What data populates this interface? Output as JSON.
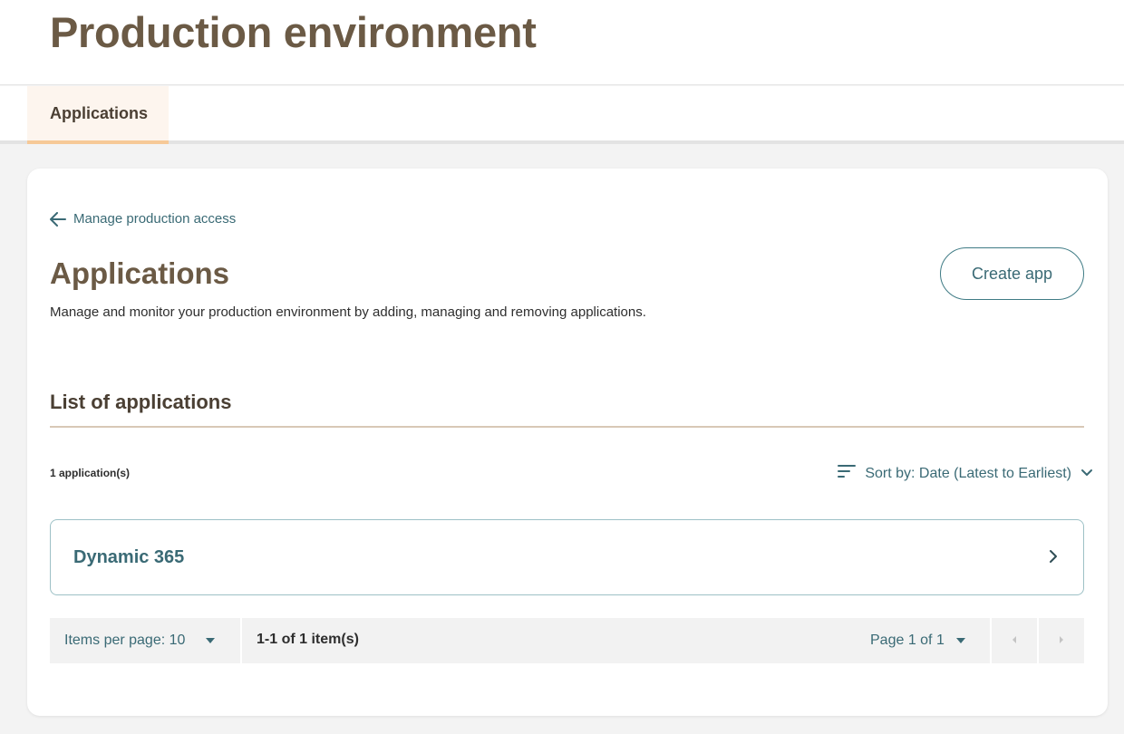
{
  "header": {
    "title": "Production environment"
  },
  "tabs": [
    {
      "label": "Applications",
      "active": true
    }
  ],
  "back_link": {
    "label": "Manage production access",
    "icon": "arrow-left-icon"
  },
  "section": {
    "title": "Applications",
    "description": "Manage and monitor your production environment by adding, managing and removing applications.",
    "create_label": "Create app"
  },
  "list": {
    "title": "List of applications",
    "count": "1 application(s)",
    "sort_label": "Sort by: Date (Latest to Earliest)",
    "items": [
      {
        "name": "Dynamic 365"
      }
    ]
  },
  "pagination": {
    "items_per_page": "Items per page: 10",
    "range": "1-1 of 1 item(s)",
    "page": "Page 1 of 1"
  },
  "colors": {
    "title_brown": "#6b5a45",
    "teal": "#3a6a75",
    "tab_accent": "#f6c997",
    "tab_bg": "#fdf5ee",
    "page_bg": "#f3f3f3"
  }
}
